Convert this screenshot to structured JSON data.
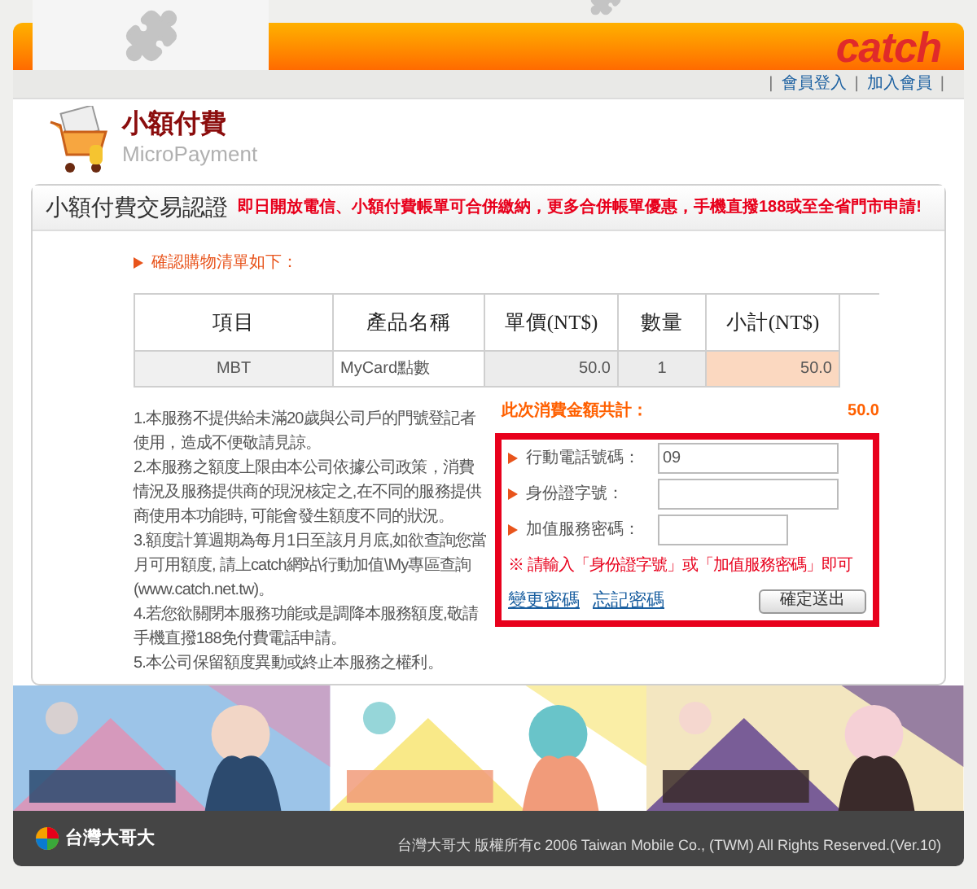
{
  "header": {
    "logo": "catch"
  },
  "nav": {
    "separators": [
      "|",
      "|",
      "|"
    ],
    "links": [
      "會員登入",
      "加入會員"
    ]
  },
  "page_title": "小額付費",
  "page_subtitle": "MicroPayment",
  "card": {
    "title": "小額付費交易認證",
    "notice": "即日開放電信、小額付費帳單可合併繳納，更多合併帳單優惠，手機直撥188或至全省門市申請!"
  },
  "list_heading": "確認購物清單如下：",
  "table": {
    "columns": [
      "項目",
      "產品名稱",
      "單價(NT$)",
      "數量",
      "小計(NT$)"
    ],
    "rows": [
      {
        "cells": [
          "MBT",
          "MyCard點數",
          "50.0",
          "1",
          "50.0"
        ]
      }
    ]
  },
  "total": {
    "label": "此次消費金額共計：",
    "value": "50.0"
  },
  "notes": [
    "1.本服務不提供給未滿20歲與公司戶的門號登記者使用，造成不便敬請見諒。",
    "2.本服務之額度上限由本公司依據公司政策，消費情況及服務提供商的現況核定之,在不同的服務提供商使用本功能時, 可能會發生額度不同的狀況。",
    "3.額度計算週期為每月1日至該月月底,如欲查詢您當月可用額度, 請上catch網站\\行動加值\\My專區查詢(www.catch.net.tw)。",
    "4.若您欲關閉本服務功能或是調降本服務額度,敬請手機直撥188免付費電話申請。",
    "5.本公司保留額度異動或終止本服務之權利。"
  ],
  "form": {
    "fields": [
      {
        "label": "行動電話號碼：",
        "value": "09",
        "kind": "wide"
      },
      {
        "label": "身份證字號：",
        "kind": "wide"
      },
      {
        "label": "加值服務密碼：",
        "kind": "narrow"
      }
    ],
    "hint": "※ 請輸入「身份證字號」或「加值服務密碼」即可",
    "links": [
      "變更密碼",
      "忘記密碼"
    ],
    "submit": "確定送出"
  },
  "footer": {
    "brand": "台灣大哥大",
    "copyright": "台灣大哥大 版權所有c 2006 Taiwan Mobile Co., (TWM) All Rights Reserved.(Ver.10)"
  }
}
